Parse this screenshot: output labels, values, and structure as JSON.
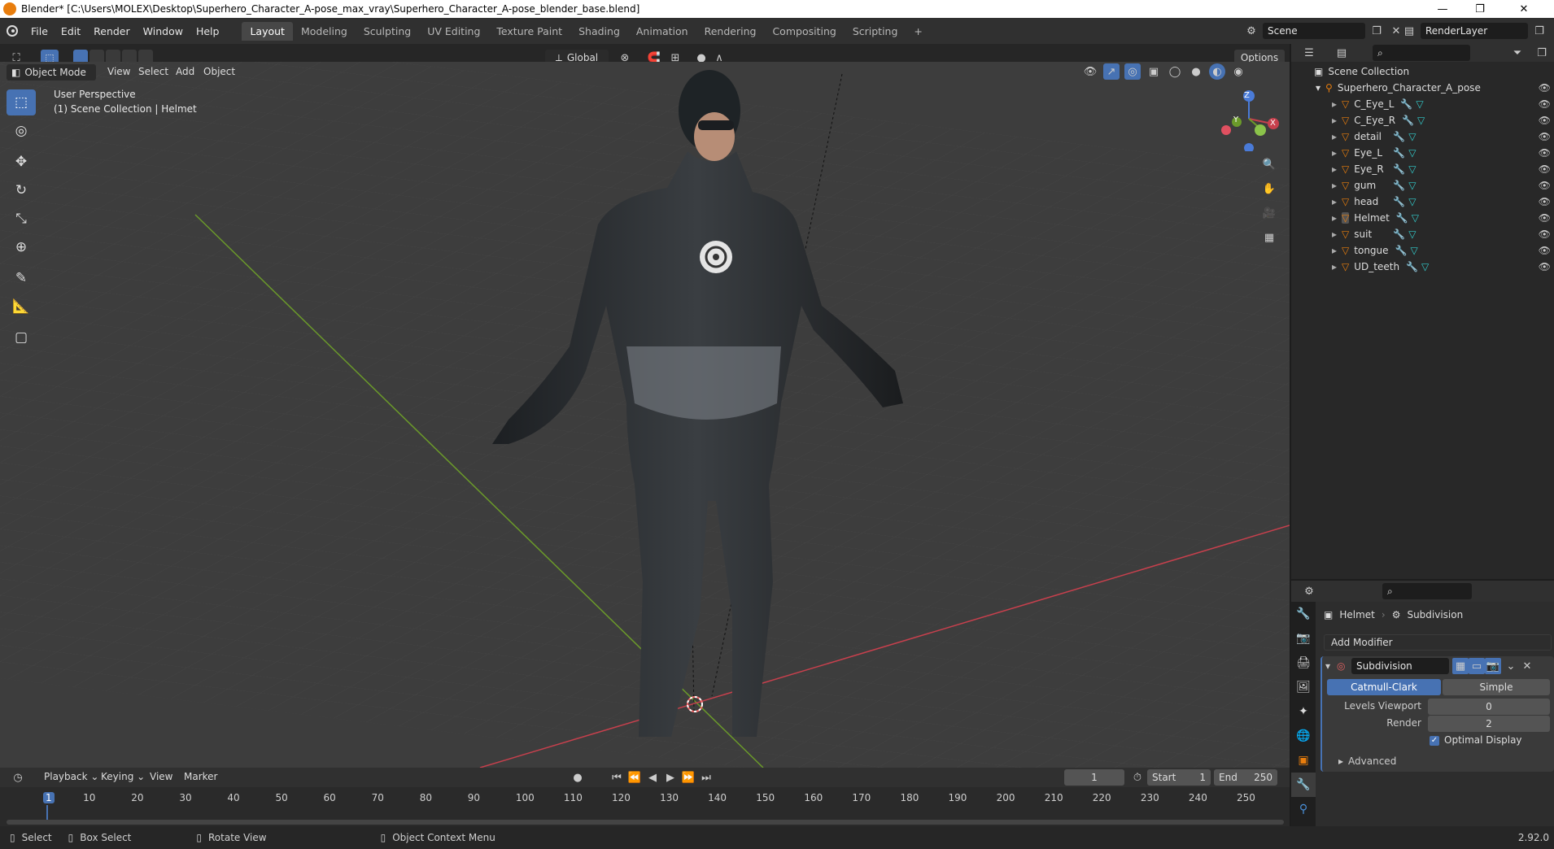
{
  "window": {
    "title": "Blender* [C:\\Users\\MOLEX\\Desktop\\Superhero_Character_A-pose_max_vray\\Superhero_Character_A-pose_blender_base.blend]",
    "minimize": "—",
    "maximize": "❐",
    "close": "✕"
  },
  "menu": [
    "File",
    "Edit",
    "Render",
    "Window",
    "Help"
  ],
  "workspaces": [
    "Layout",
    "Modeling",
    "Sculpting",
    "UV Editing",
    "Texture Paint",
    "Shading",
    "Animation",
    "Rendering",
    "Compositing",
    "Scripting"
  ],
  "workspace_active": "Layout",
  "add_workspace": "+",
  "scene": {
    "value": "Scene"
  },
  "render_layer": {
    "value": "RenderLayer"
  },
  "viewport_header": {
    "mode": "Object Mode",
    "view": "View",
    "select": "Select",
    "add": "Add",
    "object": "Object",
    "orientation": "Global",
    "options": "Options"
  },
  "viewport": {
    "perspective": "User Perspective",
    "collection": "(1) Scene Collection | Helmet"
  },
  "gizmo": {
    "z": "Z",
    "y": "Y",
    "x": "X"
  },
  "outliner": {
    "root": "Scene Collection",
    "collection": "Superhero_Character_A_pose",
    "items": [
      "C_Eye_L",
      "C_Eye_R",
      "detail",
      "Eye_L",
      "Eye_R",
      "gum",
      "head",
      "Helmet",
      "suit",
      "tongue",
      "UD_teeth"
    ]
  },
  "properties": {
    "object": "Helmet",
    "modifier_crumb": "Subdivision",
    "add_modifier": "Add Modifier",
    "modifier_name": "Subdivision",
    "catmull": "Catmull-Clark",
    "simple": "Simple",
    "levels_label": "Levels Viewport",
    "levels_value": "0",
    "render_label": "Render",
    "render_value": "2",
    "optimal": "Optimal Display",
    "advanced": "Advanced"
  },
  "timeline": {
    "playback": "Playback",
    "keying": "Keying",
    "view": "View",
    "marker": "Marker",
    "current_frame": "1",
    "start_label": "Start",
    "start": "1",
    "end_label": "End",
    "end": "250",
    "ticks": [
      "1",
      "10",
      "20",
      "30",
      "40",
      "50",
      "60",
      "70",
      "80",
      "90",
      "100",
      "110",
      "120",
      "130",
      "140",
      "150",
      "160",
      "170",
      "180",
      "190",
      "200",
      "210",
      "220",
      "230",
      "240",
      "250"
    ]
  },
  "status": {
    "select": "Select",
    "box": "Box Select",
    "rotate": "Rotate View",
    "context": "Object Context Menu",
    "version": "2.92.0"
  },
  "colors": {
    "accent": "#4772b3",
    "orange": "#e87d0d",
    "xaxis": "#c7404d",
    "yaxis": "#6b9a2a"
  }
}
